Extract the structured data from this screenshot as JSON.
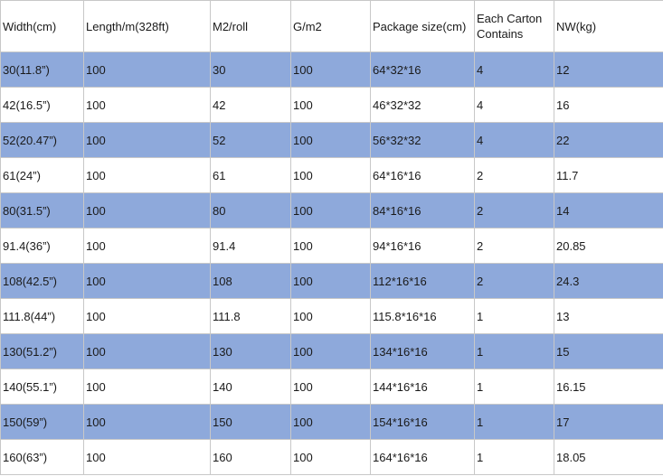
{
  "headers": [
    "Width(cm)",
    "Length/m(328ft)",
    "M2/roll",
    "G/m2",
    "Package size(cm)",
    "Each Carton Contains",
    "NW(kg)"
  ],
  "rows": [
    [
      "30(11.8”)",
      "100",
      "30",
      "100",
      "64*32*16",
      "4",
      "12"
    ],
    [
      "42(16.5”)",
      "100",
      "42",
      "100",
      "46*32*32",
      "4",
      "16"
    ],
    [
      "52(20.47”)",
      "100",
      "52",
      "100",
      "56*32*32",
      "4",
      "22"
    ],
    [
      "61(24”)",
      "100",
      "61",
      "100",
      "64*16*16",
      "2",
      "11.7"
    ],
    [
      "80(31.5”)",
      "100",
      "80",
      "100",
      "84*16*16",
      "2",
      "14"
    ],
    [
      "91.4(36”)",
      "100",
      "91.4",
      "100",
      "94*16*16",
      "2",
      "20.85"
    ],
    [
      "108(42.5”)",
      "100",
      "108",
      "100",
      "112*16*16",
      "2",
      "24.3"
    ],
    [
      "111.8(44”)",
      "100",
      "111.8",
      "100",
      "115.8*16*16",
      "1",
      "13"
    ],
    [
      "130(51.2”)",
      "100",
      "130",
      "100",
      "134*16*16",
      "1",
      "15"
    ],
    [
      "140(55.1”)",
      "100",
      "140",
      "100",
      "144*16*16",
      "1",
      "16.15"
    ],
    [
      "150(59”)",
      "100",
      "150",
      "100",
      "154*16*16",
      "1",
      "17"
    ],
    [
      "160(63”)",
      "100",
      "160",
      "100",
      "164*16*16",
      "1",
      "18.05"
    ]
  ],
  "colors": {
    "band": "#8ea9db",
    "background": "#ffffff",
    "text": "#1a1a1a",
    "border": "#c8c8c8"
  }
}
